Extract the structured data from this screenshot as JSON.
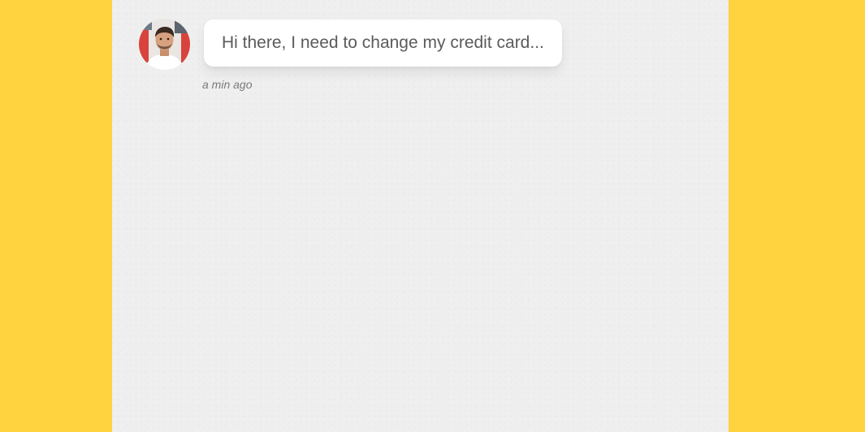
{
  "colors": {
    "background": "#FFD23F",
    "panel": "#efefef",
    "bubble": "#ffffff",
    "message_text": "#5b5b5b",
    "timestamp_text": "#7a7a7a"
  },
  "chat": {
    "messages": [
      {
        "avatar_icon": "user-avatar",
        "text": "Hi there, I need to change my credit card...",
        "time": "a min ago"
      }
    ]
  }
}
